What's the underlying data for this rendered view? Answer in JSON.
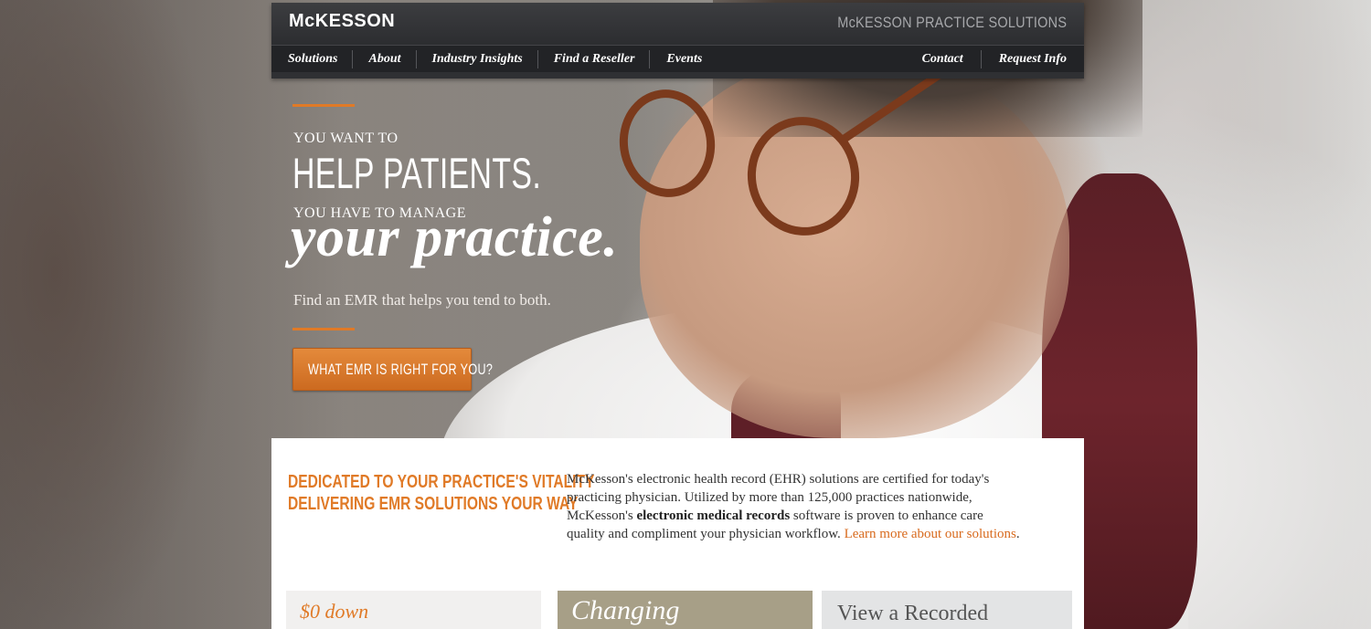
{
  "colors": {
    "accent": "#e07a27",
    "header_bg": "#2f3033",
    "nav_bg": "#222326",
    "card_tan": "#a79f87"
  },
  "header": {
    "logo": "McKESSON",
    "title": "McKESSON PRACTICE SOLUTIONS"
  },
  "nav": {
    "left": [
      "Solutions",
      "About",
      "Industry Insights",
      "Find a Reseller",
      "Events"
    ],
    "right": [
      "Contact",
      "Request Info"
    ]
  },
  "hero": {
    "eyebrow_1": "You want to",
    "headline_1": "HELP PATIENTS.",
    "eyebrow_2": "You have to manage",
    "headline_2": "your practice.",
    "subline": "Find an EMR that helps you tend to both.",
    "cta_label": "WHAT EMR IS RIGHT FOR YOU?"
  },
  "panel": {
    "heading_line_1": "DEDICATED TO YOUR PRACTICE'S VITALITY",
    "heading_line_2": "DELIVERING EMR SOLUTIONS YOUR WAY",
    "body_part_1": "McKesson's electronic health record (EHR) solutions are certified for today's practicing physician. Utilized by more than 125,000 practices nationwide, McKesson's ",
    "body_bold": "electronic medical records",
    "body_part_2": " software is proven to enhance care quality and compliment your physician workflow. ",
    "body_link": "Learn more about our solutions",
    "body_end": "."
  },
  "cards": [
    {
      "label": "$0 down"
    },
    {
      "label": "Changing"
    },
    {
      "label": "View a Recorded"
    }
  ]
}
